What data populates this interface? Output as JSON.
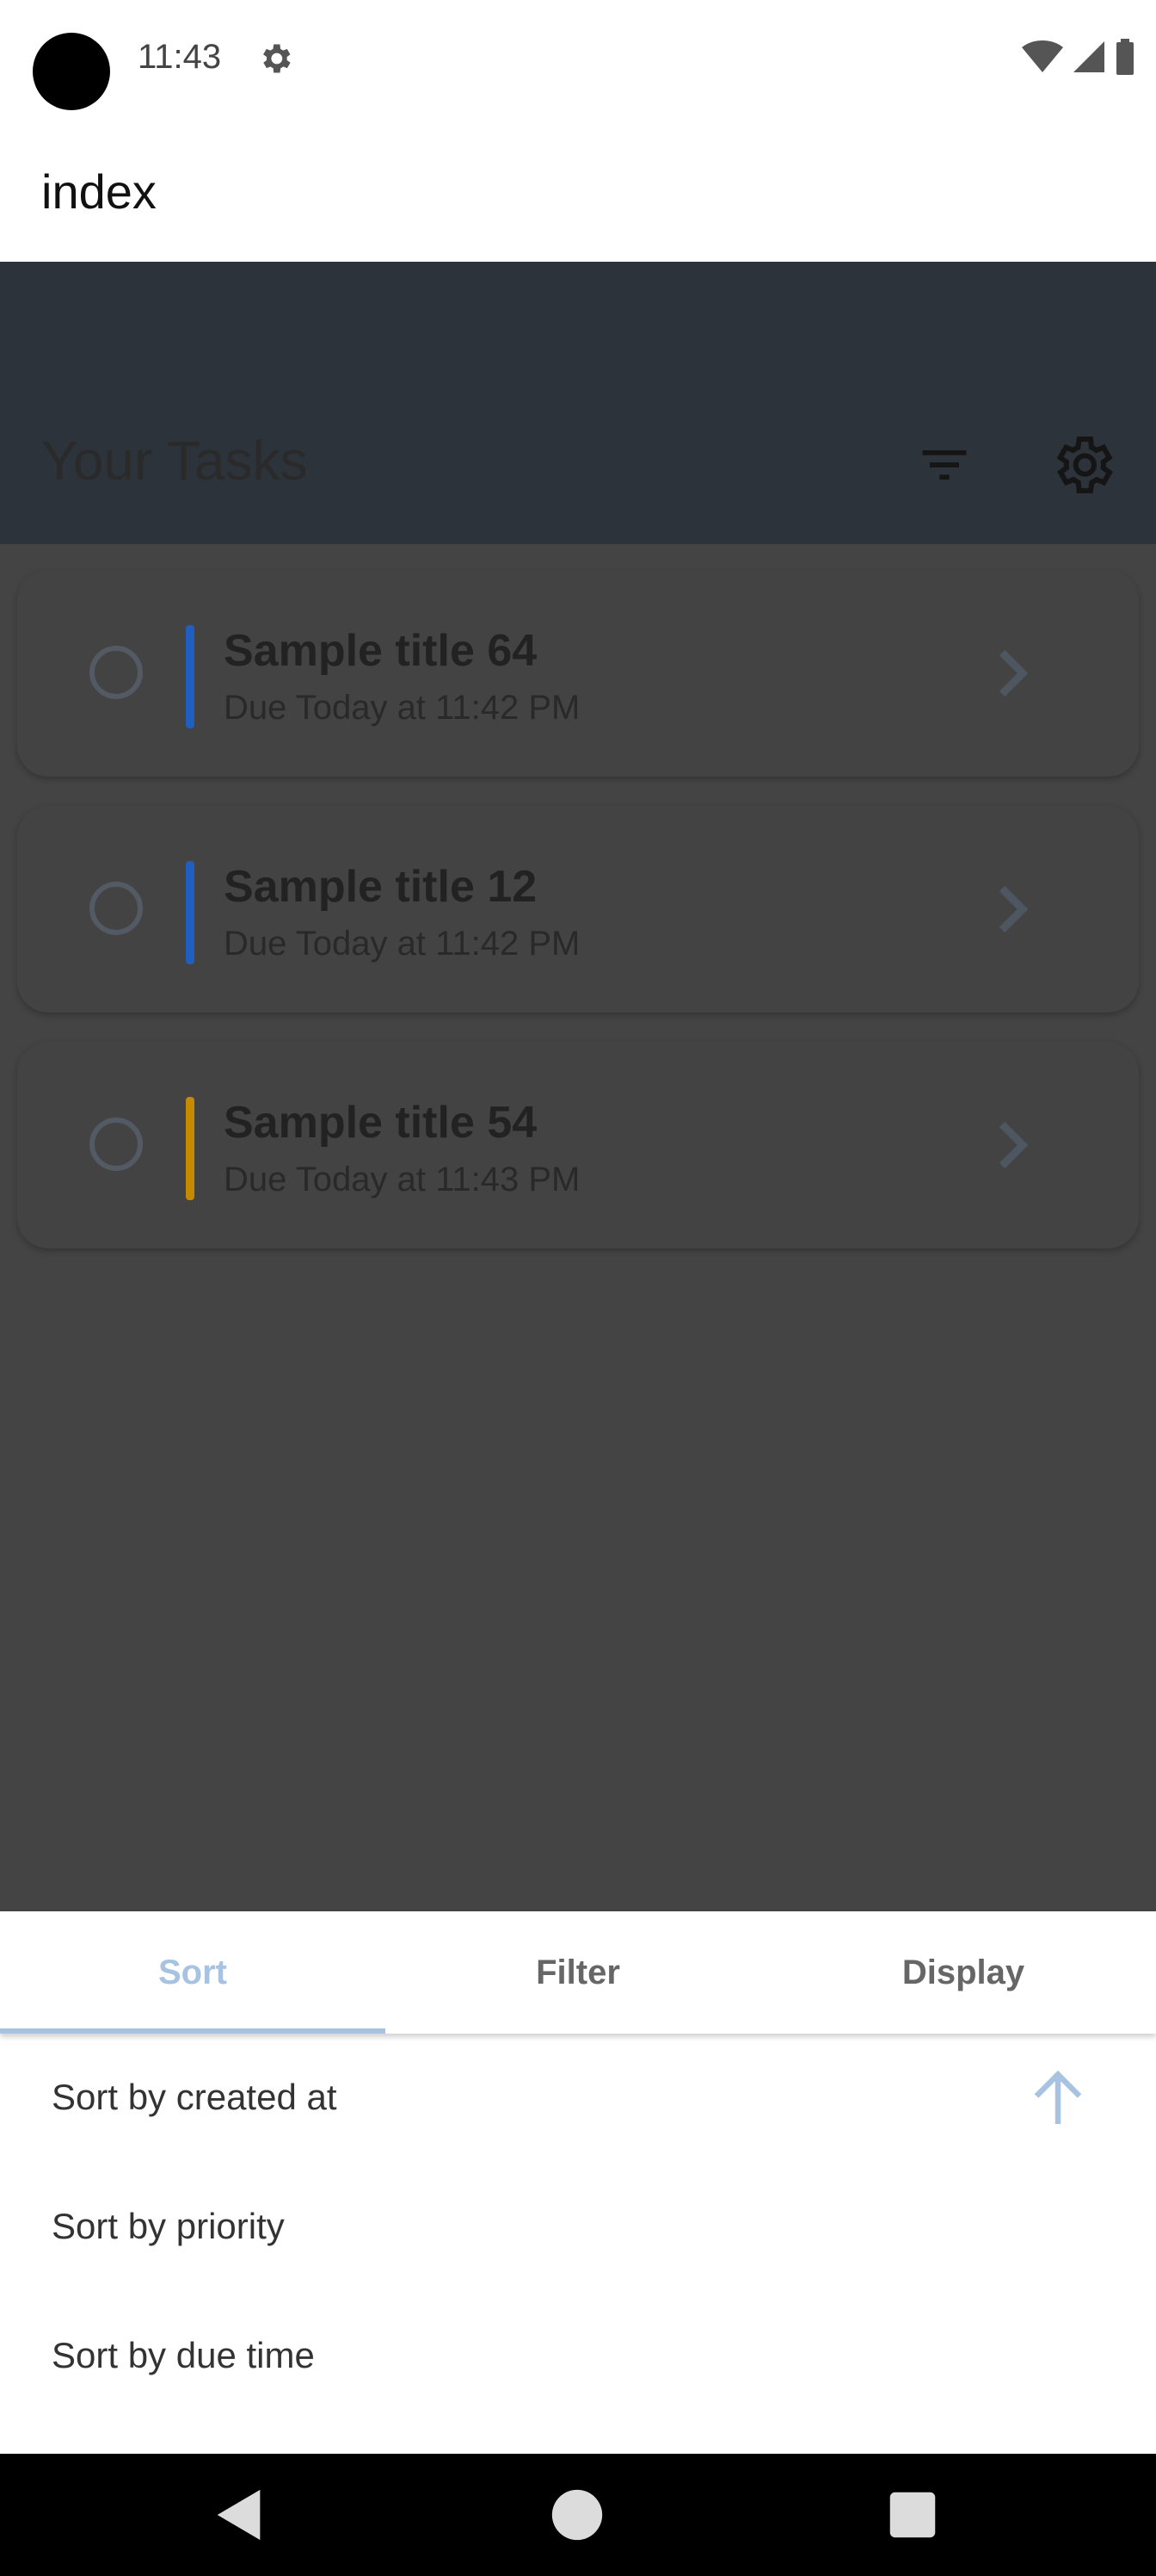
{
  "status_bar": {
    "time": "11:43"
  },
  "app_bar": {
    "title": "index"
  },
  "header": {
    "title": "Your Tasks"
  },
  "tasks": [
    {
      "title": "Sample title 64",
      "due": "Due Today at 11:42 PM",
      "priority_color": "#1f5fbf"
    },
    {
      "title": "Sample title 12",
      "due": "Due Today at 11:42 PM",
      "priority_color": "#1f5fbf"
    },
    {
      "title": "Sample title 54",
      "due": "Due Today at 11:43 PM",
      "priority_color": "#c58a00"
    }
  ],
  "sheet": {
    "tabs": [
      {
        "label": "Sort",
        "active": true
      },
      {
        "label": "Filter",
        "active": false
      },
      {
        "label": "Display",
        "active": false
      }
    ],
    "sort_options": [
      {
        "label": "Sort by created at",
        "direction": "ascending"
      },
      {
        "label": "Sort by priority"
      },
      {
        "label": "Sort by due time"
      }
    ]
  },
  "colors": {
    "accent": "#a8c2e2",
    "header_bg": "#2d333b",
    "scrim_bg": "#444444"
  }
}
